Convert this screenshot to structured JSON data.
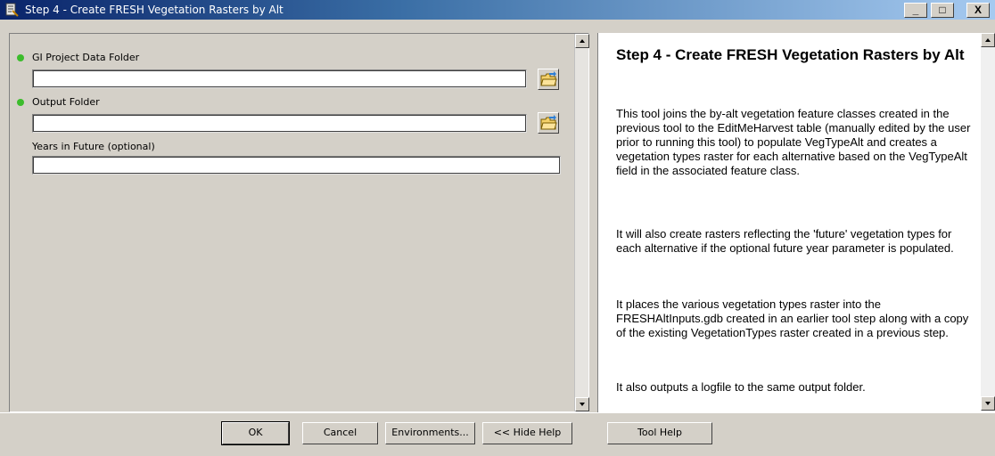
{
  "window": {
    "title": "Step 4 - Create FRESH Vegetation Rasters by Alt",
    "minimize_glyph": "_",
    "maximize_glyph": "□",
    "close_glyph": "X"
  },
  "parameters": [
    {
      "label": "GI Project Data Folder",
      "value": "",
      "required": true
    },
    {
      "label": "Output Folder",
      "value": "",
      "required": true
    },
    {
      "label": "Years in Future (optional)",
      "value": "",
      "required": false
    }
  ],
  "help": {
    "title": "Step 4 - Create FRESH Vegetation Rasters by Alt",
    "paragraphs": [
      "This tool joins the by-alt vegetation feature classes created in the previous tool to the EditMeHarvest table (manually edited by the user prior to running this tool) to populate VegTypeAlt and creates a vegetation types raster for each alternative based on the VegTypeAlt field in the associated feature class.",
      "It will also create rasters reflecting the 'future' vegetation types for each alternative if the optional future year parameter is populated.",
      "It places the various vegetation types raster into the FRESHAltInputs.gdb created in an earlier tool step along with a copy of the existing VegetationTypes raster created in a previous step.",
      "It also outputs a logfile to the same output folder."
    ]
  },
  "buttons": {
    "ok": "OK",
    "cancel": "Cancel",
    "environments": "Environments...",
    "hide_help": "<< Hide Help",
    "tool_help": "Tool Help"
  },
  "colors": {
    "required_dot": "#3cbc2c",
    "titlebar_start": "#0a246a",
    "dialog_bg": "#d4d0c8"
  },
  "icons": {
    "app": "toolbox-script-icon",
    "browse": "folder-open-icon"
  }
}
